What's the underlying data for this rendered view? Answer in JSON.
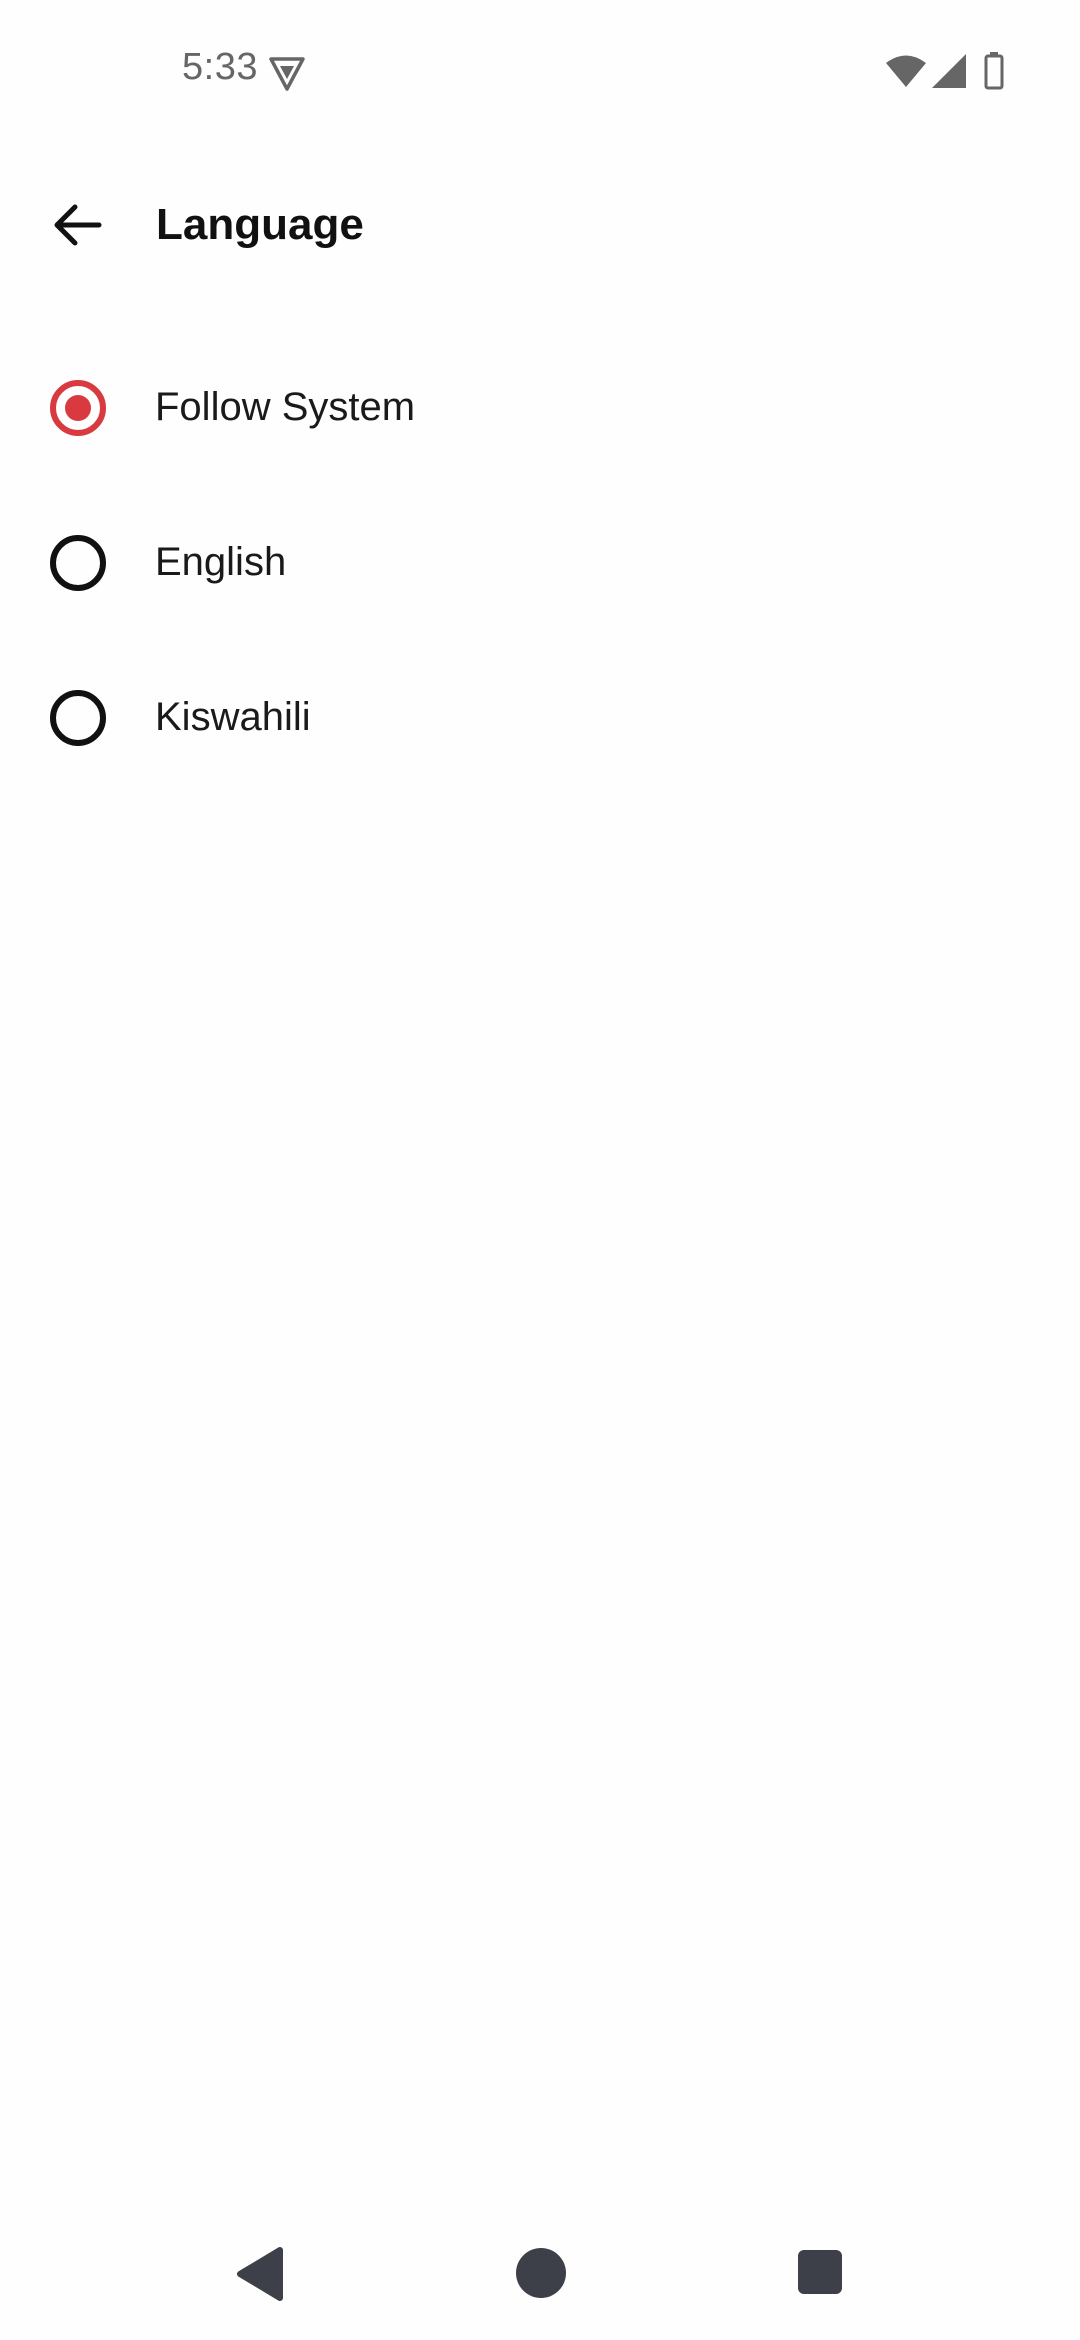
{
  "status_bar": {
    "time": "5:33",
    "vpn_icon": "shield-vpn-icon",
    "wifi_icon": "wifi-icon",
    "signal_icon": "cell-signal-icon",
    "battery_icon": "battery-icon"
  },
  "app_bar": {
    "back_icon": "arrow-left-icon",
    "title": "Language"
  },
  "language_options": [
    {
      "label": "Follow System",
      "selected": true
    },
    {
      "label": "English",
      "selected": false
    },
    {
      "label": "Kiswahili",
      "selected": false
    }
  ],
  "colors": {
    "accent": "#D93A3F",
    "text": "#111111",
    "nav_buttons": "#3E4049"
  },
  "nav_bar": {
    "back_icon": "triangle-back-icon",
    "home_icon": "circle-home-icon",
    "recents_icon": "square-recents-icon"
  }
}
